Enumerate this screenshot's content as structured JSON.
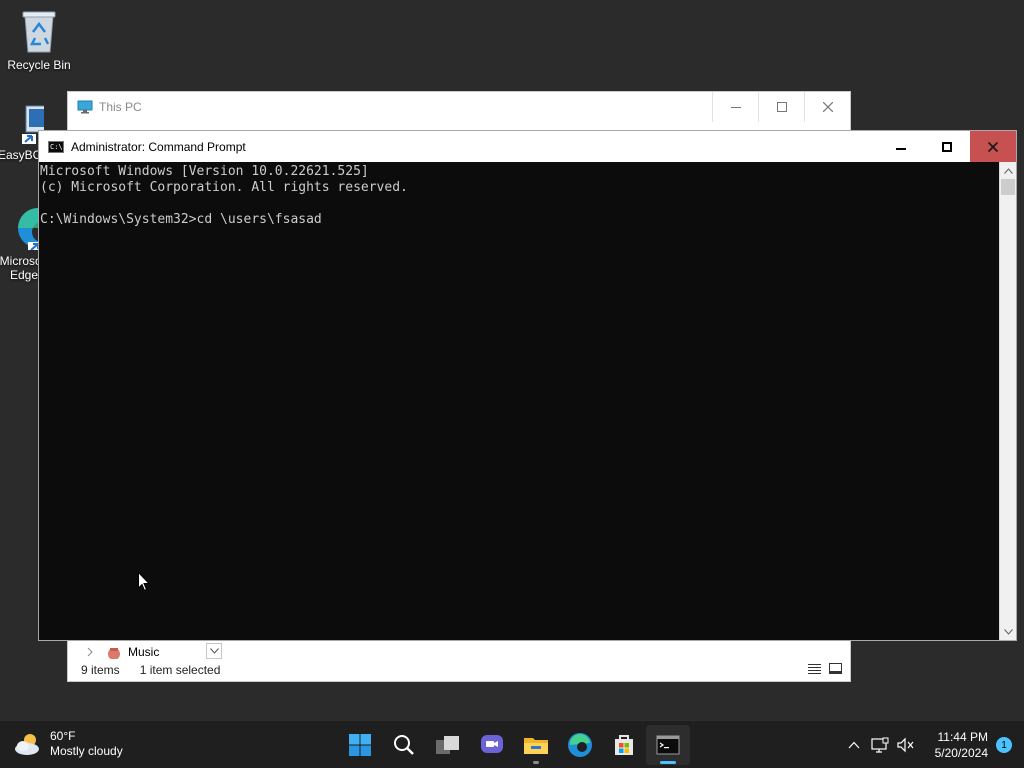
{
  "desktop": {
    "icons": [
      {
        "label": "Recycle Bin"
      },
      {
        "label": "EasyBCD"
      },
      {
        "label": "Microsoft Edge"
      }
    ]
  },
  "explorer": {
    "title": "This PC",
    "nav_item": "Music",
    "status": {
      "items": "9 items",
      "selected": "1 item selected"
    }
  },
  "cmd": {
    "title": "Administrator: Command Prompt",
    "console_lines": [
      "Microsoft Windows [Version 10.0.22621.525]",
      "(c) Microsoft Corporation. All rights reserved.",
      "",
      "C:\\Windows\\System32>cd \\users\\fsasad"
    ]
  },
  "taskbar": {
    "weather": {
      "temperature": "60°F",
      "condition": "Mostly cloudy"
    },
    "apps": [
      {
        "name": "start-icon",
        "active": false
      },
      {
        "name": "search-icon",
        "active": false
      },
      {
        "name": "task-view-icon",
        "active": false
      },
      {
        "name": "chat-icon",
        "active": false
      },
      {
        "name": "file-explorer-icon",
        "active": false
      },
      {
        "name": "edge-icon",
        "active": false
      },
      {
        "name": "store-icon",
        "active": false
      },
      {
        "name": "terminal-icon",
        "active": true
      }
    ],
    "clock": {
      "time": "11:44 PM",
      "date": "5/20/2024"
    },
    "notification_count": "1"
  },
  "colors": {
    "taskbar_bg": "#1f1f1f",
    "console_bg": "#0c0c0c",
    "console_fg": "#cccccc",
    "close_red": "#c75050",
    "accent": "#4cc2ff"
  }
}
